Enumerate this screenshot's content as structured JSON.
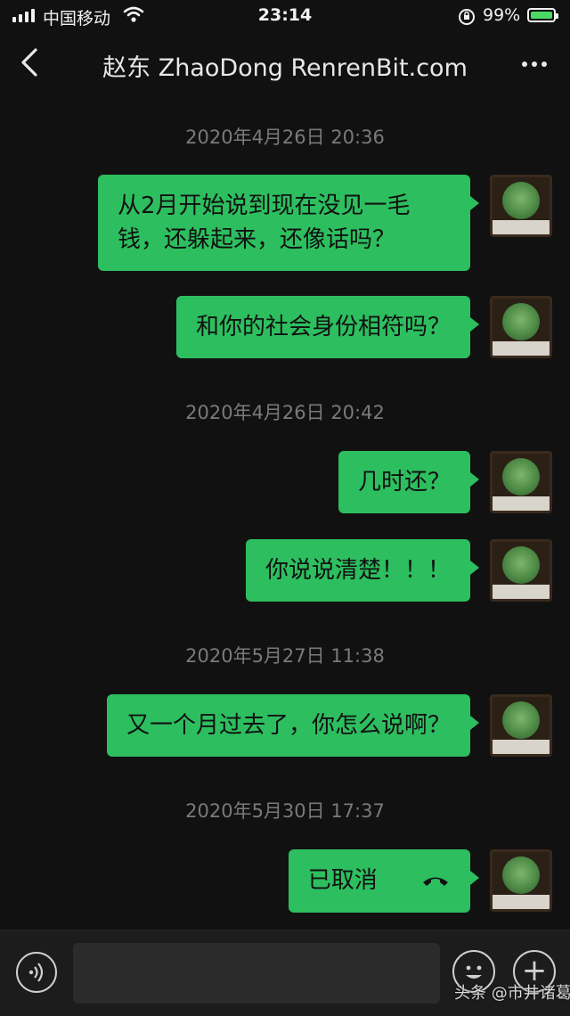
{
  "status_bar": {
    "carrier": "中国移动",
    "time": "23:14",
    "battery_percent": "99%",
    "battery_level": 0.99,
    "signal_bars": 4,
    "icons": [
      "wifi-icon",
      "orientation-lock-icon",
      "battery-charging-icon"
    ]
  },
  "nav": {
    "title": "赵东 ZhaoDong RenrenBit.com",
    "back_icon": "chevron-left-icon",
    "more_icon": "more-dots-icon"
  },
  "timestamps": [
    "2020年4月26日 20:36",
    "2020年4月26日 20:42",
    "2020年5月27日 11:38",
    "2020年5月30日 17:37"
  ],
  "messages": [
    {
      "text": "从2月开始说到现在没见一毛钱，还躲起来，还像话吗？",
      "sender": "self"
    },
    {
      "text": "和你的社会身份相符吗？",
      "sender": "self"
    },
    {
      "text": "几时还？",
      "sender": "self"
    },
    {
      "text": "你说说清楚！！！",
      "sender": "self"
    },
    {
      "text": "又一个月过去了，你怎么说啊？",
      "sender": "self"
    },
    {
      "text": "已取消",
      "sender": "self",
      "type": "voice-call",
      "icon": "phone-hangup-icon"
    }
  ],
  "input_bar": {
    "voice_icon": "voice-input-icon",
    "emoji_icon": "emoji-icon",
    "plus_icon": "plus-icon",
    "placeholder": ""
  },
  "watermark": "头条 @市井诸葛",
  "colors": {
    "background": "#111111",
    "bubble": "#2dbe5f",
    "timestamp": "#7a7a7a"
  }
}
